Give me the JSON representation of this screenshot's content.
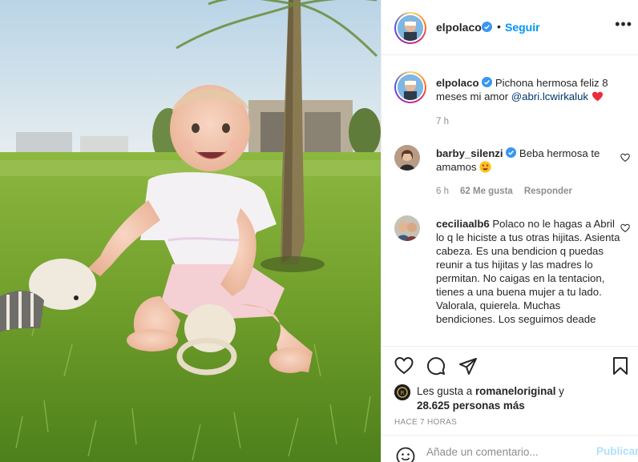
{
  "post_header": {
    "username": "elpolaco",
    "dot": "•",
    "follow_label": "Seguir",
    "more_label": "•••"
  },
  "caption": {
    "username": "elpolaco",
    "text": "Pichona hermosa feliz 8 meses mi amor ",
    "mention": "@abri.lcwirkaluk",
    "time": "7 h"
  },
  "comments": [
    {
      "username": "barby_silenzi",
      "text": "Beba hermosa te amamos",
      "time": "6 h",
      "likes": "62 Me gusta",
      "reply_label": "Responder"
    },
    {
      "username": "ceciliaalb6",
      "text": "Polaco no le hagas a Abril lo q le hiciste a tus otras hijitas. Asienta cabeza. Es una bendicion q puedas reunir a tus hijitas y las madres lo permitan. No caigas en la tentacion, tienes a una buena mujer a tu lado. Valorala, quierela. Muchas bendiciones. Los seguimos deade"
    }
  ],
  "likes": {
    "prefix": "Les gusta a ",
    "user": "romaneloriginal",
    "joiner": " y",
    "others": "28.625 personas más"
  },
  "timestamp": "HACE 7 HORAS",
  "comment_box": {
    "placeholder": "Añade un comentario...",
    "publish_label": "Publicar"
  },
  "colors": {
    "link_blue": "#0095f6",
    "mention_blue": "#00376b",
    "muted_gray": "#8e8e8e",
    "publish_disabled": "#b2dffc",
    "heart_red": "#ed4956"
  },
  "icons": {
    "verified": "verified-badge-icon",
    "like": "heart-icon",
    "comment": "comment-bubble-icon",
    "share": "paper-plane-icon",
    "save": "bookmark-icon",
    "emoji": "smiley-icon",
    "more": "more-options-icon"
  }
}
